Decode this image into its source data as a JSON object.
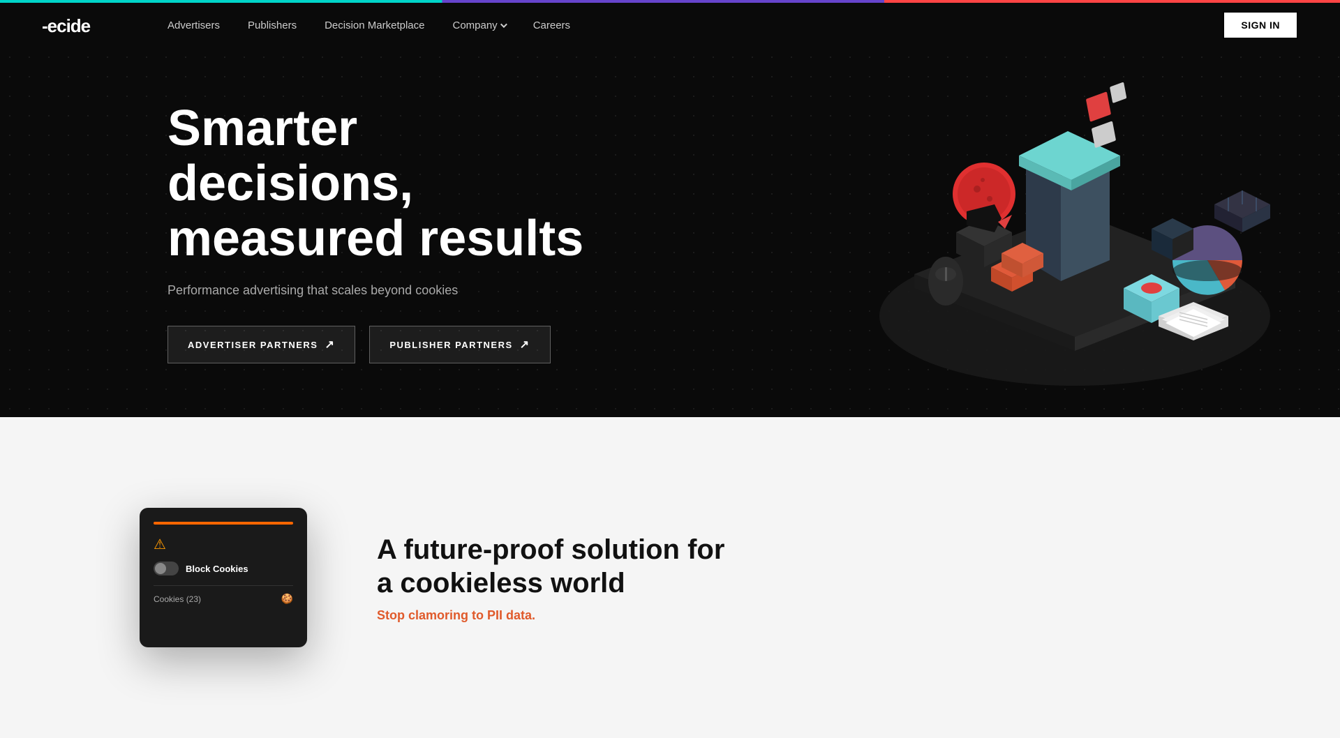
{
  "topbar": {
    "colors": [
      "#00d4c8",
      "#6644cc",
      "#ff4444"
    ]
  },
  "nav": {
    "logo_text": "Decide",
    "links": [
      {
        "label": "Advertisers",
        "href": "#"
      },
      {
        "label": "Publishers",
        "href": "#"
      },
      {
        "label": "Decision Marketplace",
        "href": "#"
      },
      {
        "label": "Company",
        "href": "#",
        "has_dropdown": true
      },
      {
        "label": "Careers",
        "href": "#"
      }
    ],
    "sign_in_label": "SIGN IN"
  },
  "hero": {
    "title": "Smarter decisions, measured results",
    "subtitle": "Performance advertising that scales beyond cookies",
    "btn_advertiser": "ADVERTISER PARTNERS",
    "btn_publisher": "PUBLISHER PARTNERS"
  },
  "section2": {
    "heading": "A future-proof solution for\na cookieless world",
    "highlight": "Stop clamoring to PII data.",
    "mockup": {
      "block_cookies_label": "Block Cookies",
      "cookies_label": "Cookies (23)"
    }
  }
}
